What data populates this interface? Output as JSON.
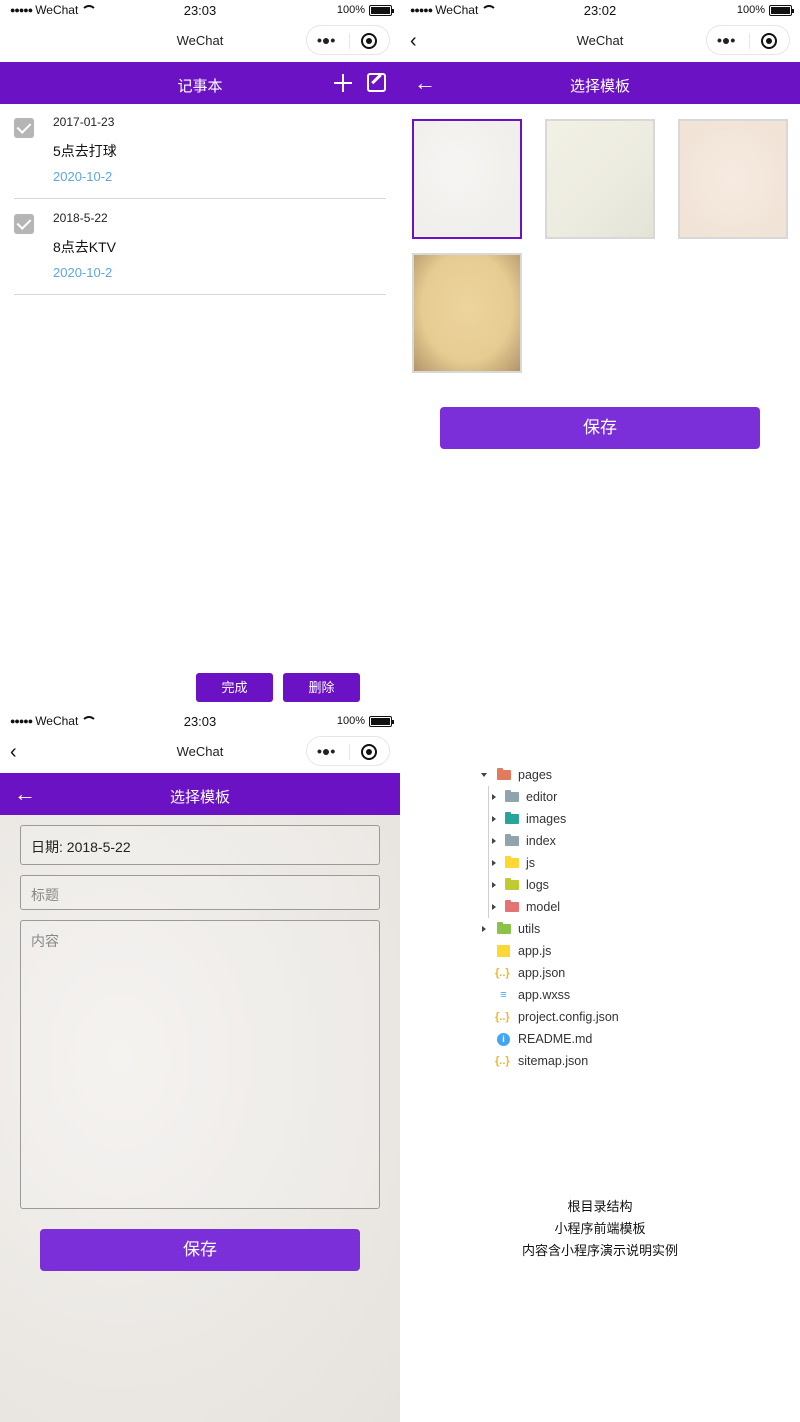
{
  "status": {
    "carrier": "WeChat",
    "battery": "100%",
    "time_a": "23:03",
    "time_b": "23:02",
    "time_c": "23:03"
  },
  "wechat": {
    "title": "WeChat"
  },
  "list_page": {
    "header": "记事本",
    "notes": [
      {
        "date": "2017-01-23",
        "text": "5点去打球",
        "stamp": "2020-10-2"
      },
      {
        "date": "2018-5-22",
        "text": "8点去KTV",
        "stamp": "2020-10-2"
      }
    ],
    "done_label": "完成",
    "delete_label": "删除"
  },
  "template_page": {
    "header": "选择模板",
    "templates": [
      "#f0efec",
      "#ecebe0",
      "#f1e3d6",
      "#e6cc92"
    ],
    "selected": 0,
    "save_label": "保存"
  },
  "editor_page": {
    "header": "选择模板",
    "date_field": "日期: 2018-5-22",
    "title_placeholder": "标题",
    "content_placeholder": "内容",
    "save_label": "保存"
  },
  "tree": {
    "root": "pages",
    "children": [
      "editor",
      "images",
      "index",
      "js",
      "logs",
      "model"
    ],
    "utils": "utils",
    "files": [
      "app.js",
      "app.json",
      "app.wxss",
      "project.config.json",
      "README.md",
      "sitemap.json"
    ]
  },
  "caption": {
    "line1": "根目录结构",
    "line2": "小程序前端模板",
    "line3": "内容含小程序演示说明实例"
  },
  "colors": {
    "accent": "#6a12c4",
    "button": "#7b2fd8",
    "link": "#5aa8dc"
  }
}
